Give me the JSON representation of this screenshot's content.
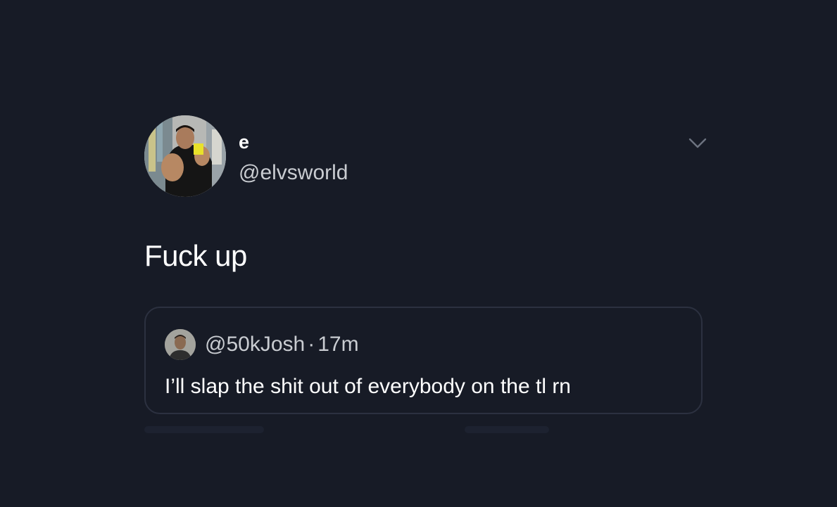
{
  "tweet": {
    "author": {
      "display_name": "e",
      "handle": "@elvsworld",
      "avatar_icon": "profile-photo"
    },
    "menu_icon": "chevron-down-icon",
    "text": "Fuck up",
    "quoted_tweet": {
      "handle": "@50kJosh",
      "separator": "·",
      "time": "17m",
      "avatar_icon": "profile-photo",
      "text": "I’ll slap the shit out of everybody on the tl rn"
    }
  },
  "colors": {
    "background": "#171b26",
    "card_border": "#2c3140",
    "secondary_text": "#c9ccd1",
    "primary_text": "#ffffff"
  }
}
